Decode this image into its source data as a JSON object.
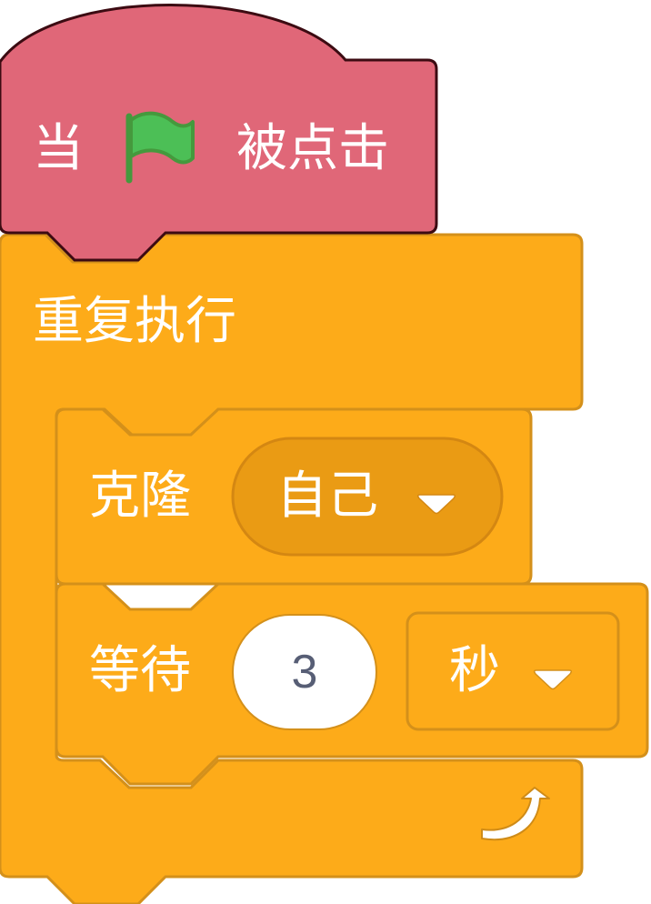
{
  "colors": {
    "events": "#e06778",
    "events_border": "#3c0b12",
    "control": "#fdab19",
    "control_border": "#d4901a",
    "menu_pill": "#ea9b14",
    "flag_green": "#4cbf56",
    "flag_dark": "#45993d",
    "number_text": "#575e75"
  },
  "hat_block": {
    "prefix": "当",
    "flag_icon": "green-flag",
    "suffix": "被点击"
  },
  "forever_block": {
    "label": "重复执行",
    "loop_icon": "loop-arrow"
  },
  "create_clone_block": {
    "label": "克隆",
    "menu_value": "自己"
  },
  "wait_block": {
    "label": "等待",
    "number_value": "3",
    "unit_value": "秒"
  }
}
